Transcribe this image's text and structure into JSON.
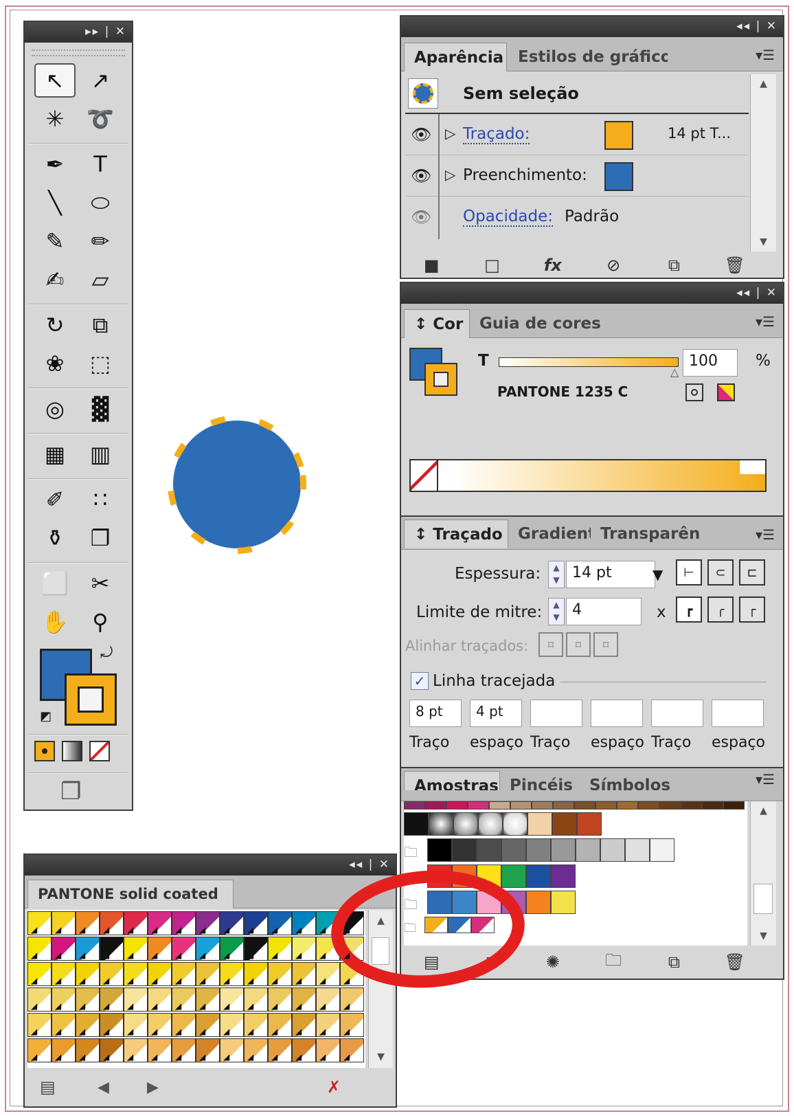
{
  "colors": {
    "blue": "#2d6db5",
    "orange": "#f4ae1b",
    "red_annotation": "#e4201f"
  },
  "toolbar": {
    "titlebar_controls": "▸▸ | ✕",
    "tools": [
      {
        "name": "selection-tool",
        "glyph": "↖"
      },
      {
        "name": "direct-selection-tool",
        "glyph": "↗"
      },
      {
        "name": "magic-wand-tool",
        "glyph": "✳"
      },
      {
        "name": "lasso-tool",
        "glyph": "➰"
      },
      {
        "name": "pen-tool",
        "glyph": "✒"
      },
      {
        "name": "type-tool",
        "glyph": "T"
      },
      {
        "name": "line-tool",
        "glyph": "╲"
      },
      {
        "name": "ellipse-tool",
        "glyph": "⬭"
      },
      {
        "name": "paintbrush-tool",
        "glyph": "✎"
      },
      {
        "name": "pencil-tool",
        "glyph": "✏"
      },
      {
        "name": "blob-brush-tool",
        "glyph": "✍"
      },
      {
        "name": "eraser-tool",
        "glyph": "▱"
      },
      {
        "name": "rotate-tool",
        "glyph": "↻"
      },
      {
        "name": "scale-tool",
        "glyph": "⧉"
      },
      {
        "name": "warp-tool",
        "glyph": "❀"
      },
      {
        "name": "free-transform-tool",
        "glyph": "⬚"
      },
      {
        "name": "symbol-sprayer-tool",
        "glyph": "◎"
      },
      {
        "name": "graph-tool",
        "glyph": "▓"
      },
      {
        "name": "mesh-tool",
        "glyph": "▦"
      },
      {
        "name": "gradient-tool",
        "glyph": "▥"
      },
      {
        "name": "eyedropper-tool",
        "glyph": "✐"
      },
      {
        "name": "blend-tool",
        "glyph": "∷"
      },
      {
        "name": "live-paint-bucket-tool",
        "glyph": "⚱"
      },
      {
        "name": "live-paint-selection-tool",
        "glyph": "❐"
      },
      {
        "name": "artboard-tool",
        "glyph": "⬜"
      },
      {
        "name": "slice-tool",
        "glyph": "✂"
      },
      {
        "name": "hand-tool",
        "glyph": "✋"
      },
      {
        "name": "zoom-tool",
        "glyph": "⚲"
      }
    ]
  },
  "appearance": {
    "tabs": [
      "Aparência",
      "Estilos de gráfico"
    ],
    "no_selection": "Sem seleção",
    "stroke_label": "Traçado:",
    "stroke_value": "14 pt T...",
    "fill_label": "Preenchimento:",
    "opacity_label": "Opacidade:",
    "opacity_value": "Padrão"
  },
  "color_panel": {
    "tabs": [
      "↕ Cor",
      "Guia de cores"
    ],
    "tint_label": "T",
    "tint_value": "100",
    "percent": "%",
    "swatch_name": "PANTONE 1235 C"
  },
  "stroke_panel": {
    "tabs": [
      "↕ Traçado",
      "Gradiente",
      "Transparênc"
    ],
    "weight_label": "Espessura:",
    "weight_value": "14 pt",
    "miter_label": "Limite de mitre:",
    "miter_value": "4",
    "miter_x": "x",
    "align_label": "Alinhar traçados:",
    "dashed_label": "Linha tracejada",
    "dash_values": [
      "8 pt",
      "4 pt",
      "",
      "",
      "",
      ""
    ],
    "dash_labels": [
      "Traço",
      "espaço",
      "Traço",
      "espaço",
      "Traço",
      "espaço"
    ]
  },
  "swatches_panel": {
    "tabs": [
      "Amostras",
      "Pincéis",
      "Símbolos"
    ],
    "top_strip": [
      "#8a2a6b",
      "#a2175b",
      "#c8165a",
      "#d72d7c",
      "#c9a98a",
      "#b89372",
      "#a07b5c",
      "#8a6446",
      "#76502f",
      "#8c5d2c",
      "#a06a2a",
      "#7f4d1e",
      "#6b3d16",
      "#5c3312",
      "#4a2a10",
      "#3b210c"
    ],
    "pattern_row": [
      "#111",
      "#666",
      "#999",
      "#bbb",
      "#ddd",
      "#f2d0a8",
      "#8b4513",
      "#c0441f"
    ],
    "gray_row": [
      "#000",
      "#333",
      "#4d4d4d",
      "#666",
      "#808080",
      "#999",
      "#b3b3b3",
      "#ccc",
      "#e0e0e0",
      "#f2f2f2"
    ],
    "bright_row": [
      "#e12a27",
      "#f26b21",
      "#fde01a",
      "#1ea54b",
      "#1d4fa0",
      "#6d2c91"
    ],
    "pastel_row": [
      "#2d6db5",
      "#3b86c8",
      "#f6a6c8",
      "#a95cb0",
      "#f5821f",
      "#f3e14b"
    ],
    "group_row": [
      "#f4ae1b",
      "#2d6db5",
      "#d72d7c"
    ]
  },
  "pantone_panel": {
    "title": "PANTONE solid coated",
    "titlebar_controls": "◂◂ | ✕",
    "rows": [
      [
        "#f6e11a",
        "#f4d21f",
        "#f08a24",
        "#e5552b",
        "#de2a4a",
        "#d82a86",
        "#c0238c",
        "#8b2d8d",
        "#2e3a8e",
        "#1d3f92",
        "#1462ad",
        "#0082c0",
        "#00a0b0",
        "#0f0f0f"
      ],
      [
        "#f7e500",
        "#d4177c",
        "#1a9bd7",
        "#111111",
        "#f2e400",
        "#ef8a1f",
        "#e8327c",
        "#1aa0d8",
        "#0c9a4b",
        "#111111",
        "#f0e400",
        "#f3eb6a",
        "#f4e44a",
        "#ede06a"
      ],
      [
        "#f7e600",
        "#f5dc1a",
        "#f2d300",
        "#f0cb2a",
        "#f5dc1a",
        "#f2d300",
        "#f0cb2a",
        "#ecc236",
        "#f5dc1a",
        "#f2d300",
        "#f0cb2a",
        "#ecc236",
        "#f8e277",
        "#f3d551"
      ],
      [
        "#f3db74",
        "#edcf5f",
        "#e2bd49",
        "#d2a83a",
        "#f8e49d",
        "#f4d97e",
        "#ecc95f",
        "#dfb443",
        "#f8e49d",
        "#f4d97e",
        "#ecc95f",
        "#dfb443",
        "#f6d98e",
        "#efc96b"
      ],
      [
        "#f4d35a",
        "#efc143",
        "#e3ac33",
        "#c98f24",
        "#f7dc86",
        "#f3cd66",
        "#ebb84a",
        "#da9f31",
        "#f7dc86",
        "#f3cd66",
        "#ebb84a",
        "#da9f31",
        "#f5d07a",
        "#eeb858"
      ],
      [
        "#f0b03a",
        "#e99c2b",
        "#d6861f",
        "#b96e16",
        "#f6cb7b",
        "#f1b55a",
        "#e79d3e",
        "#d5832a",
        "#f6cb7b",
        "#f1b55a",
        "#e79d3e",
        "#d5832a",
        "#f3b56a",
        "#e99a47"
      ]
    ]
  }
}
